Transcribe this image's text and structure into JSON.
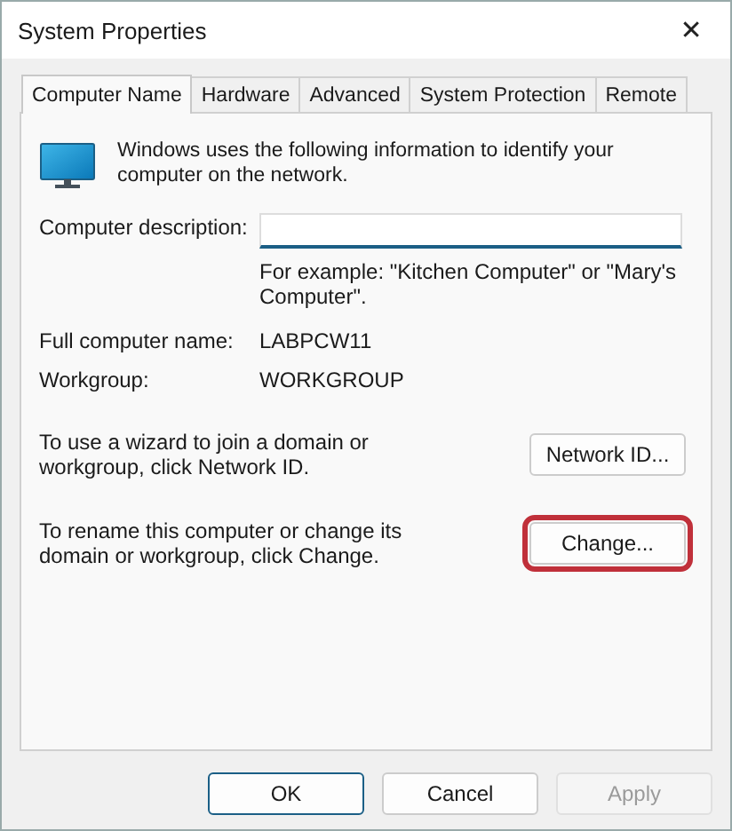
{
  "window": {
    "title": "System Properties",
    "close": "✕"
  },
  "tabs": [
    {
      "label": "Computer Name",
      "selected": true
    },
    {
      "label": "Hardware",
      "selected": false
    },
    {
      "label": "Advanced",
      "selected": false
    },
    {
      "label": "System Protection",
      "selected": false
    },
    {
      "label": "Remote",
      "selected": false
    }
  ],
  "intro": "Windows uses the following information to identify your computer on the network.",
  "description": {
    "label": "Computer description:",
    "hint": "For example: \"Kitchen Computer\" or \"Mary's Computer\"."
  },
  "info": [
    {
      "label": "Full computer name:",
      "value": "LABPCW11"
    },
    {
      "label": "Workgroup:",
      "value": "WORKGROUP"
    }
  ],
  "actions": [
    {
      "text": "To use a wizard to join a domain or workgroup, click Network ID.",
      "button": "Network ID...",
      "highlighted": false
    },
    {
      "text": "To rename this computer or change its domain or workgroup, click Change.",
      "button": "Change...",
      "highlighted": true
    }
  ],
  "buttons": [
    {
      "label": "OK",
      "default": true,
      "disabled": false
    },
    {
      "label": "Cancel",
      "default": false,
      "disabled": false
    },
    {
      "label": "Apply",
      "default": false,
      "disabled": true
    }
  ]
}
